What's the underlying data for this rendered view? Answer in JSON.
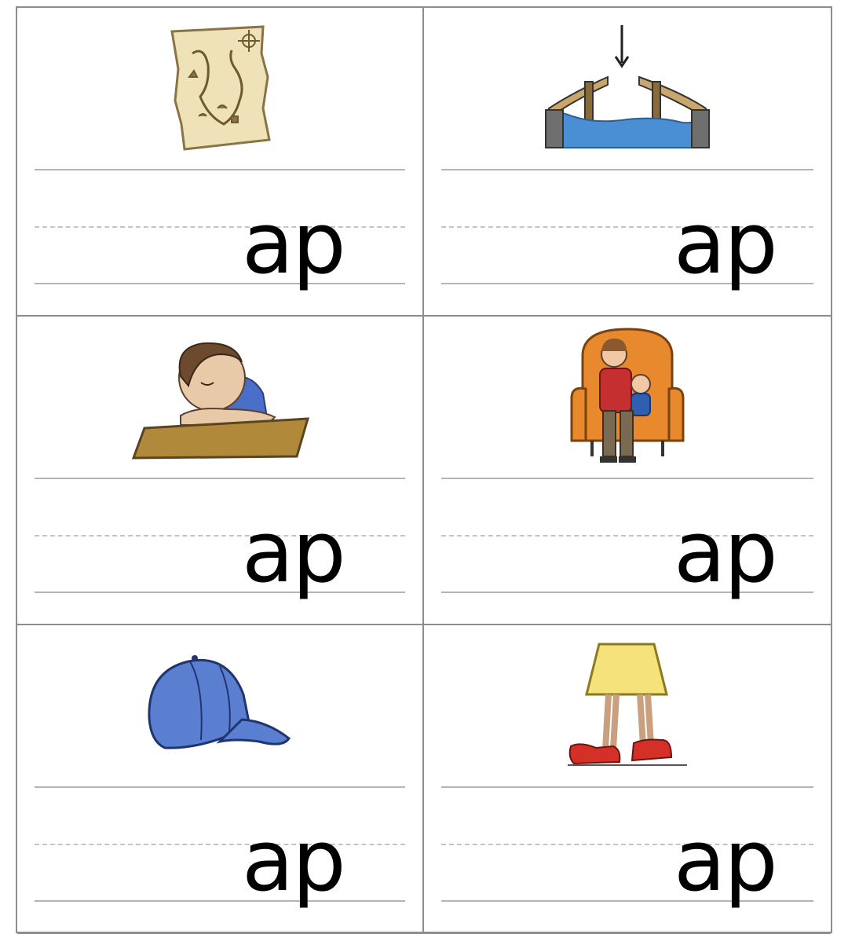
{
  "worksheet": {
    "cards": [
      {
        "picture": "treasure-map",
        "ending": "ap"
      },
      {
        "picture": "drawbridge-gap",
        "ending": "ap"
      },
      {
        "picture": "child-napping-on-desk",
        "ending": "ap"
      },
      {
        "picture": "parent-with-child-on-lap",
        "ending": "ap"
      },
      {
        "picture": "baseball-cap",
        "ending": "ap"
      },
      {
        "picture": "legs-in-big-shoes",
        "ending": "ap"
      }
    ]
  }
}
